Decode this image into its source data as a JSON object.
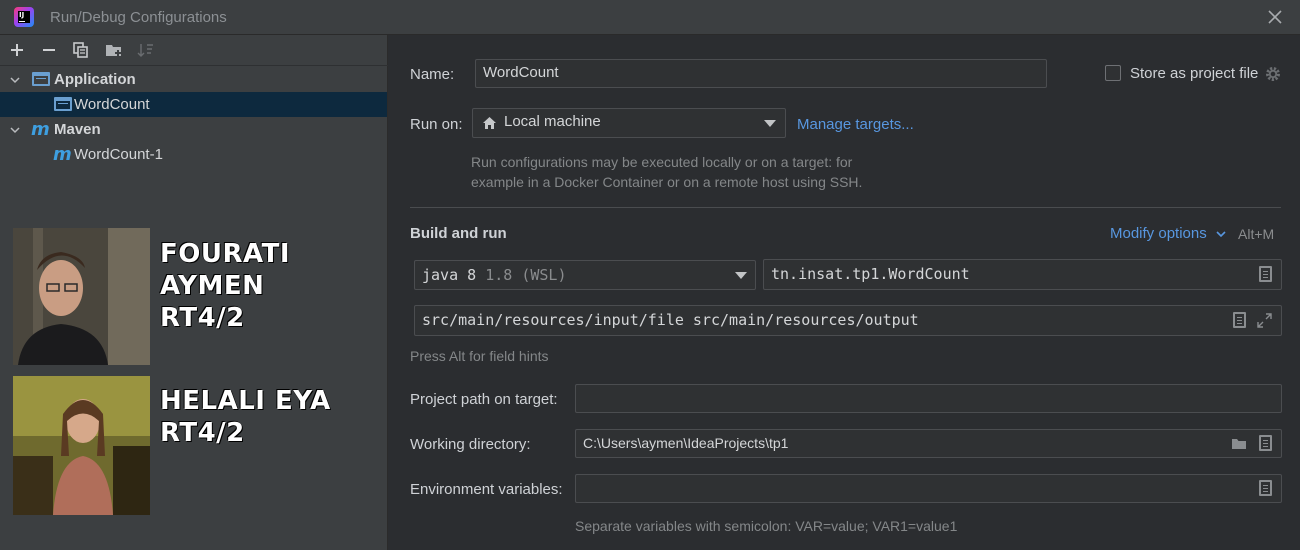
{
  "window": {
    "title": "Run/Debug Configurations",
    "close_icon": "close-icon"
  },
  "toolbar": {
    "buttons": [
      "add-icon",
      "remove-icon",
      "copy-icon",
      "folder-add-icon",
      "sort-icon"
    ]
  },
  "tree": {
    "items": [
      {
        "label": "Application",
        "icon": "application-icon",
        "expanded": true
      },
      {
        "label": "WordCount",
        "icon": "application-icon",
        "selected": true
      },
      {
        "label": "Maven",
        "icon": "maven-icon",
        "expanded": true
      },
      {
        "label": "WordCount-1",
        "icon": "maven-icon"
      }
    ]
  },
  "overlay": {
    "person1": {
      "name": "FOURATI AYMEN",
      "group": "RT4/2"
    },
    "person2": {
      "name": "HELALI EYA",
      "group": "RT4/2"
    }
  },
  "form": {
    "name_label": "Name:",
    "name_value": "WordCount",
    "store_label": "Store as project file",
    "store_checked": false,
    "run_on_label": "Run on:",
    "run_on_value": "Local machine",
    "manage_targets": "Manage targets...",
    "run_on_hint_1": "Run configurations may be executed locally or on a target: for",
    "run_on_hint_2": "example in a Docker Container or on a remote host using SSH.",
    "build_run_title": "Build and run",
    "modify_options": "Modify options",
    "modify_shortcut": "Alt+M",
    "jdk_name": "java 8",
    "jdk_version": "1.8 (WSL)",
    "main_class": "tn.insat.tp1.WordCount",
    "program_args": "src/main/resources/input/file src/main/resources/output",
    "field_hint": "Press Alt for field hints",
    "project_path_label": "Project path on target:",
    "project_path_value": "",
    "working_dir_label": "Working directory:",
    "working_dir_value": "C:\\Users\\aymen\\IdeaProjects\\tp1",
    "env_label": "Environment variables:",
    "env_value": "",
    "env_hint": "Separate variables with semicolon: VAR=value; VAR1=value1"
  },
  "colors": {
    "accent_link": "#5897e0",
    "selection": "#0d293e",
    "panel": "#3c3f41",
    "background": "#2b2d30"
  }
}
